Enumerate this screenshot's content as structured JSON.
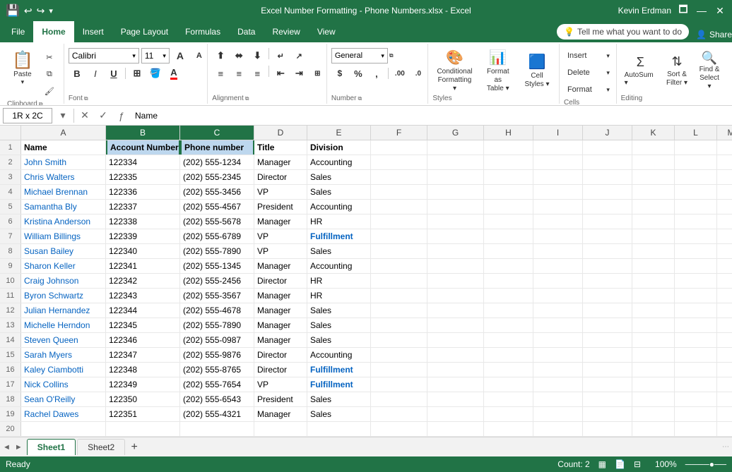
{
  "titleBar": {
    "appIcon": "💾",
    "undoRedo": "↩ ↪",
    "title": "Excel Number Formatting - Phone Numbers.xlsx - Excel",
    "userName": "Kevin Erdman",
    "windowControls": [
      "🗖",
      "—",
      "✕"
    ]
  },
  "ribbonTabs": [
    "File",
    "Home",
    "Insert",
    "Page Layout",
    "Formulas",
    "Data",
    "Review",
    "View"
  ],
  "activeTab": "Home",
  "tellMe": "Tell me what you want to do",
  "shareBtn": "Share",
  "ribbon": {
    "clipboard": {
      "label": "Clipboard",
      "paste": "Paste",
      "cut": "✂",
      "copy": "⧉",
      "formatPainter": "🖌"
    },
    "font": {
      "label": "Font",
      "fontName": "Calibri",
      "fontSize": "11",
      "bold": "B",
      "italic": "I",
      "underline": "U",
      "border": "⊞",
      "fill": "A",
      "fontColor": "A"
    },
    "alignment": {
      "label": "Alignment"
    },
    "number": {
      "label": "Number",
      "format": "General",
      "currency": "$",
      "percent": "%",
      "comma": ","
    },
    "styles": {
      "label": "Styles",
      "conditionalFormatting": "Conditional Formatting",
      "formatAsTable": "Format as Table",
      "cellStyles": "Cell Styles"
    },
    "cells": {
      "label": "Cells",
      "insert": "Insert",
      "delete": "Delete",
      "format": "Format"
    },
    "editing": {
      "label": "Editing",
      "autoSum": "Σ",
      "sortFilter": "Sort & Filter",
      "findSelect": "Find & Select"
    }
  },
  "formulaBar": {
    "cellRef": "1R x 2C",
    "formula": "Name"
  },
  "columns": [
    "A",
    "B",
    "C",
    "D",
    "E",
    "F",
    "G",
    "H",
    "I",
    "J",
    "K",
    "L",
    "M"
  ],
  "rows": [
    {
      "num": 1,
      "a": "Name",
      "b": "Account Number",
      "c": "Phone number",
      "d": "Title",
      "e": "Division",
      "f": "",
      "g": "",
      "h": "",
      "i": "",
      "j": "",
      "k": "",
      "l": "",
      "m": ""
    },
    {
      "num": 2,
      "a": "John Smith",
      "b": "122334",
      "c": "(202) 555-1234",
      "d": "Manager",
      "e": "Accounting",
      "f": "",
      "g": "",
      "h": "",
      "i": "",
      "j": "",
      "k": "",
      "l": "",
      "m": ""
    },
    {
      "num": 3,
      "a": "Chris Walters",
      "b": "122335",
      "c": "(202) 555-2345",
      "d": "Director",
      "e": "Sales",
      "f": "",
      "g": "",
      "h": "",
      "i": "",
      "j": "",
      "k": "",
      "l": "",
      "m": ""
    },
    {
      "num": 4,
      "a": "Michael Brennan",
      "b": "122336",
      "c": "(202) 555-3456",
      "d": "VP",
      "e": "Sales",
      "f": "",
      "g": "",
      "h": "",
      "i": "",
      "j": "",
      "k": "",
      "l": "",
      "m": ""
    },
    {
      "num": 5,
      "a": "Samantha Bly",
      "b": "122337",
      "c": "(202) 555-4567",
      "d": "President",
      "e": "Accounting",
      "f": "",
      "g": "",
      "h": "",
      "i": "",
      "j": "",
      "k": "",
      "l": "",
      "m": ""
    },
    {
      "num": 6,
      "a": "Kristina Anderson",
      "b": "122338",
      "c": "(202) 555-5678",
      "d": "Manager",
      "e": "HR",
      "f": "",
      "g": "",
      "h": "",
      "i": "",
      "j": "",
      "k": "",
      "l": "",
      "m": ""
    },
    {
      "num": 7,
      "a": "William Billings",
      "b": "122339",
      "c": "(202) 555-6789",
      "d": "VP",
      "e": "Fulfillment",
      "f": "",
      "g": "",
      "h": "",
      "i": "",
      "j": "",
      "k": "",
      "l": "",
      "m": ""
    },
    {
      "num": 8,
      "a": "Susan Bailey",
      "b": "122340",
      "c": "(202) 555-7890",
      "d": "VP",
      "e": "Sales",
      "f": "",
      "g": "",
      "h": "",
      "i": "",
      "j": "",
      "k": "",
      "l": "",
      "m": ""
    },
    {
      "num": 9,
      "a": "Sharon Keller",
      "b": "122341",
      "c": "(202) 555-1345",
      "d": "Manager",
      "e": "Accounting",
      "f": "",
      "g": "",
      "h": "",
      "i": "",
      "j": "",
      "k": "",
      "l": "",
      "m": ""
    },
    {
      "num": 10,
      "a": "Craig Johnson",
      "b": "122342",
      "c": "(202) 555-2456",
      "d": "Director",
      "e": "HR",
      "f": "",
      "g": "",
      "h": "",
      "i": "",
      "j": "",
      "k": "",
      "l": "",
      "m": ""
    },
    {
      "num": 11,
      "a": "Byron Schwartz",
      "b": "122343",
      "c": "(202) 555-3567",
      "d": "Manager",
      "e": "HR",
      "f": "",
      "g": "",
      "h": "",
      "i": "",
      "j": "",
      "k": "",
      "l": "",
      "m": ""
    },
    {
      "num": 12,
      "a": "Julian Hernandez",
      "b": "122344",
      "c": "(202) 555-4678",
      "d": "Manager",
      "e": "Sales",
      "f": "",
      "g": "",
      "h": "",
      "i": "",
      "j": "",
      "k": "",
      "l": "",
      "m": ""
    },
    {
      "num": 13,
      "a": "Michelle Herndon",
      "b": "122345",
      "c": "(202) 555-7890",
      "d": "Manager",
      "e": "Sales",
      "f": "",
      "g": "",
      "h": "",
      "i": "",
      "j": "",
      "k": "",
      "l": "",
      "m": ""
    },
    {
      "num": 14,
      "a": "Steven Queen",
      "b": "122346",
      "c": "(202) 555-0987",
      "d": "Manager",
      "e": "Sales",
      "f": "",
      "g": "",
      "h": "",
      "i": "",
      "j": "",
      "k": "",
      "l": "",
      "m": ""
    },
    {
      "num": 15,
      "a": "Sarah Myers",
      "b": "122347",
      "c": "(202) 555-9876",
      "d": "Director",
      "e": "Accounting",
      "f": "",
      "g": "",
      "h": "",
      "i": "",
      "j": "",
      "k": "",
      "l": "",
      "m": ""
    },
    {
      "num": 16,
      "a": "Kaley Ciambotti",
      "b": "122348",
      "c": "(202) 555-8765",
      "d": "Director",
      "e": "Fulfillment",
      "f": "",
      "g": "",
      "h": "",
      "i": "",
      "j": "",
      "k": "",
      "l": "",
      "m": ""
    },
    {
      "num": 17,
      "a": "Nick Collins",
      "b": "122349",
      "c": "(202) 555-7654",
      "d": "VP",
      "e": "Fulfillment",
      "f": "",
      "g": "",
      "h": "",
      "i": "",
      "j": "",
      "k": "",
      "l": "",
      "m": ""
    },
    {
      "num": 18,
      "a": "Sean O'Reilly",
      "b": "122350",
      "c": "(202) 555-6543",
      "d": "President",
      "e": "Sales",
      "f": "",
      "g": "",
      "h": "",
      "i": "",
      "j": "",
      "k": "",
      "l": "",
      "m": ""
    },
    {
      "num": 19,
      "a": "Rachel Dawes",
      "b": "122351",
      "c": "(202) 555-4321",
      "d": "Manager",
      "e": "Sales",
      "f": "",
      "g": "",
      "h": "",
      "i": "",
      "j": "",
      "k": "",
      "l": "",
      "m": ""
    },
    {
      "num": 20,
      "a": "",
      "b": "",
      "c": "",
      "d": "",
      "e": "",
      "f": "",
      "g": "",
      "h": "",
      "i": "",
      "j": "",
      "k": "",
      "l": "",
      "m": ""
    }
  ],
  "fulfillmentBold": [
    7,
    16,
    17
  ],
  "linkRows": [
    2,
    3,
    4,
    5,
    6,
    7,
    8,
    9,
    10,
    11,
    12,
    13,
    14,
    15,
    16,
    17,
    18,
    19
  ],
  "sheets": [
    "Sheet1",
    "Sheet2"
  ],
  "activeSheet": "Sheet1",
  "statusBar": {
    "ready": "Ready",
    "count": "Count: 2",
    "viewButtons": [
      "Normal",
      "Page Layout",
      "Page Break Preview"
    ],
    "zoom": "100%"
  },
  "colors": {
    "excelGreen": "#217346",
    "linkBlue": "#0563c1",
    "selectionBlue": "#d6e4f0"
  }
}
